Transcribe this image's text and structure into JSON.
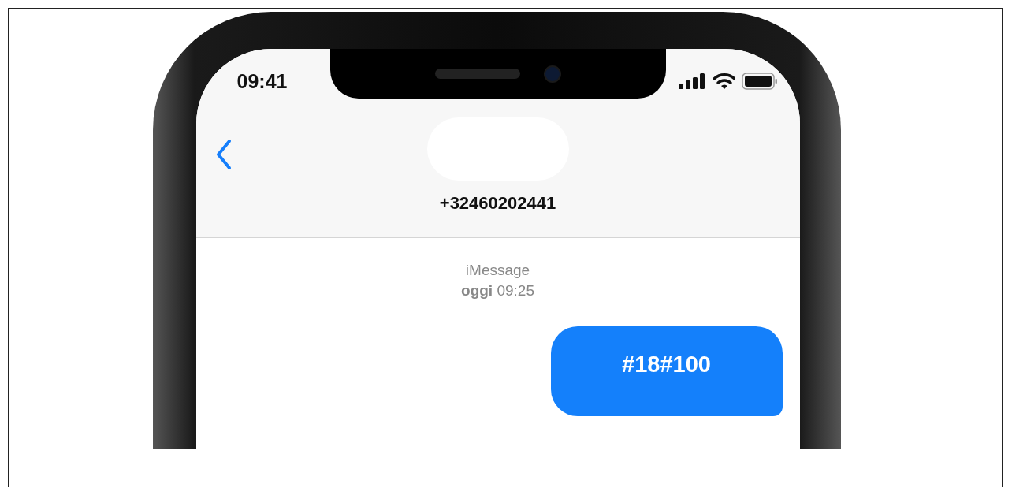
{
  "status_bar": {
    "time": "09:41"
  },
  "header": {
    "contact": "+32460202441"
  },
  "conversation": {
    "service": "iMessage",
    "timestamp": "**oggi** 09:25"
  },
  "messages": [
    {
      "kind": "sent",
      "text": "#18#100"
    }
  ]
}
